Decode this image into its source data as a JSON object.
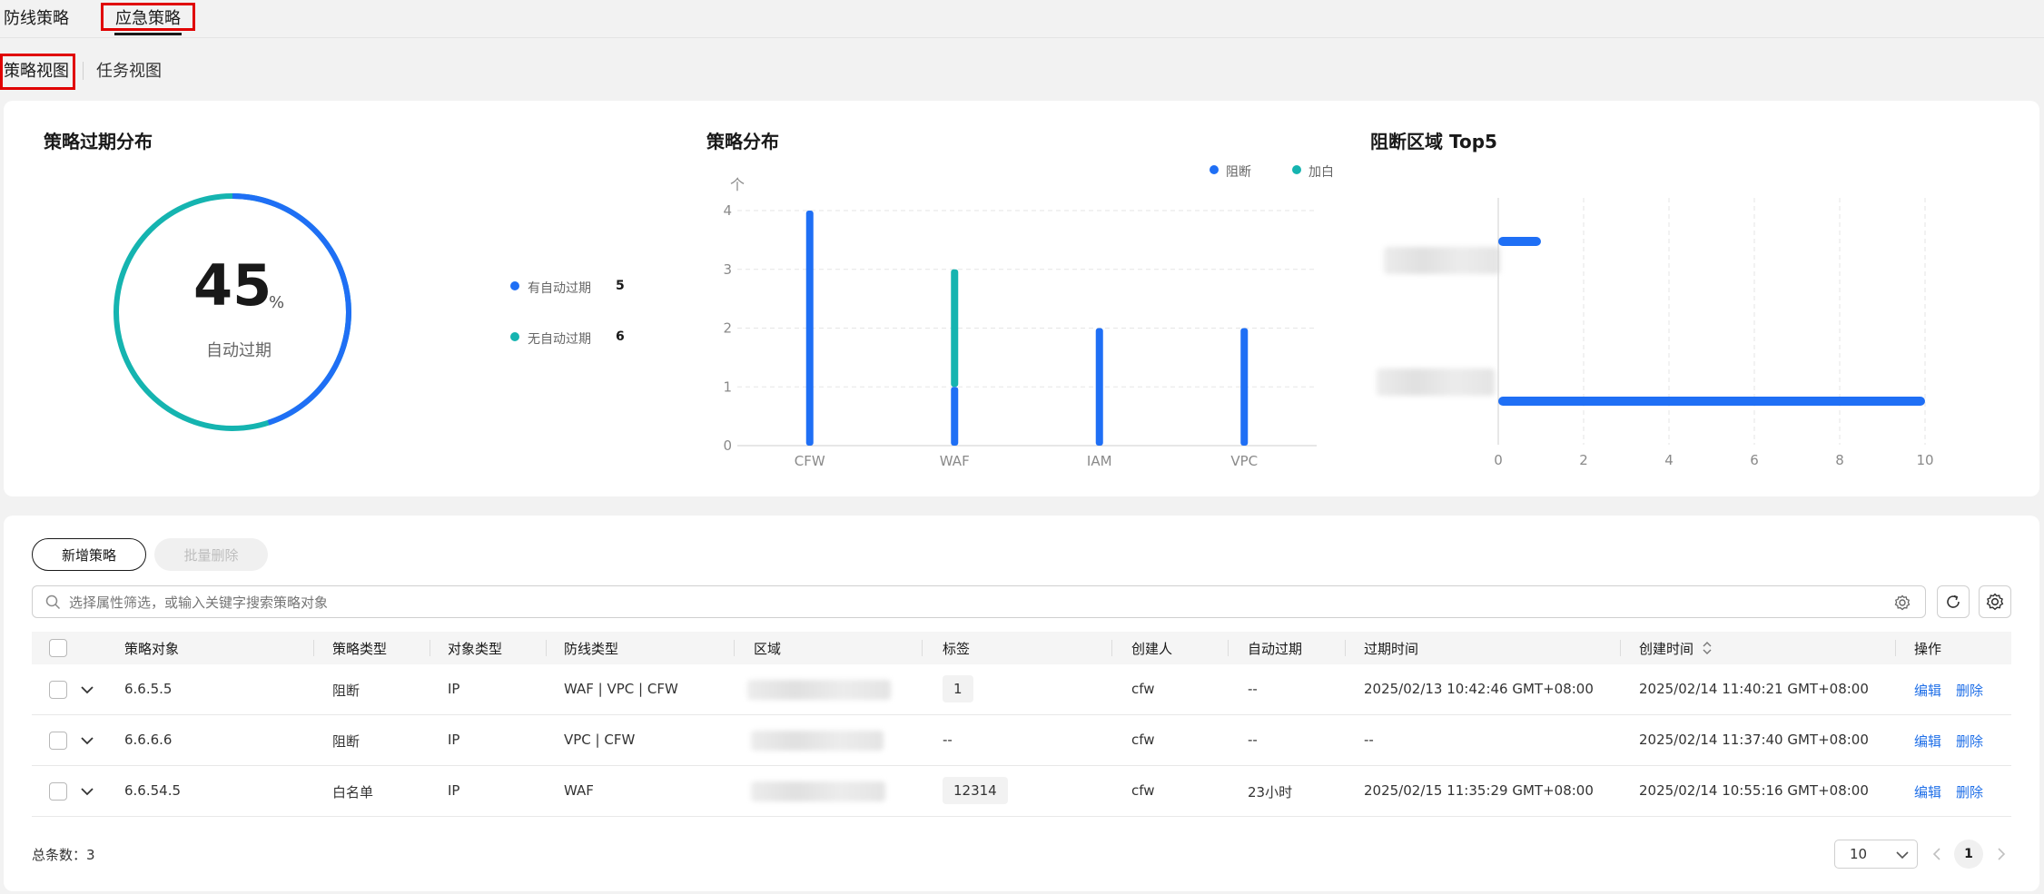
{
  "top_tabs": [
    {
      "label": "防线策略"
    },
    {
      "label": "应急策略"
    }
  ],
  "sub_tabs": [
    {
      "label": "策略视图"
    },
    {
      "label": "任务视图"
    }
  ],
  "expiry_card": {
    "title": "策略过期分布",
    "percent": "45",
    "percent_unit": "%",
    "center_label": "自动过期",
    "legend": [
      {
        "label": "有自动过期",
        "value": "5",
        "color": "#1f6ff5"
      },
      {
        "label": "无自动过期",
        "value": "6",
        "color": "#15b4b0"
      }
    ]
  },
  "dist_card": {
    "title": "策略分布",
    "chart_data": {
      "type": "bar",
      "title": "策略分布",
      "ylabel": "个",
      "categories": [
        "CFW",
        "WAF",
        "IAM",
        "VPC"
      ],
      "series": [
        {
          "name": "阻断",
          "color": "#1f6ff5",
          "values": [
            4,
            1,
            2,
            2
          ]
        },
        {
          "name": "加白",
          "color": "#15b4b0",
          "values": [
            0,
            2,
            0,
            0
          ]
        }
      ],
      "ylim": [
        0,
        4
      ],
      "yticks": [
        "0",
        "1",
        "2",
        "3",
        "4"
      ],
      "stacked": true,
      "legend_position": "top-right",
      "grid": true
    }
  },
  "top5_card": {
    "title": "阻断区域 Top5",
    "chart_data": {
      "type": "bar",
      "orientation": "horizontal",
      "title": "阻断区域 Top5",
      "categories": [
        "",
        ""
      ],
      "values": [
        1,
        10
      ],
      "xlim": [
        0,
        10
      ],
      "xticks": [
        "0",
        "2",
        "4",
        "6",
        "8",
        "10"
      ],
      "color": "#1f6ff5",
      "grid": true
    }
  },
  "toolbar": {
    "add_label": "新增策略",
    "batch_delete_label": "批量删除",
    "search_placeholder": "选择属性筛选，或输入关键字搜索策略对象"
  },
  "table": {
    "columns": [
      "策略对象",
      "策略类型",
      "对象类型",
      "防线类型",
      "区域",
      "标签",
      "创建人",
      "自动过期",
      "过期时间",
      "创建时间",
      "操作"
    ],
    "rows": [
      {
        "object": "6.6.5.5",
        "policy_type": "阻断",
        "object_type": "IP",
        "defense": "WAF | VPC | CFW",
        "tag": "1",
        "creator": "cfw",
        "auto_expire": "--",
        "expire_time": "2025/02/13 10:42:46 GMT+08:00",
        "create_time": "2025/02/14 11:40:21 GMT+08:00",
        "edit": "编辑",
        "delete": "删除"
      },
      {
        "object": "6.6.6.6",
        "policy_type": "阻断",
        "object_type": "IP",
        "defense": "VPC | CFW",
        "tag": "--",
        "creator": "cfw",
        "auto_expire": "--",
        "expire_time": "--",
        "create_time": "2025/02/14 11:37:40 GMT+08:00",
        "edit": "编辑",
        "delete": "删除"
      },
      {
        "object": "6.6.54.5",
        "policy_type": "白名单",
        "object_type": "IP",
        "defense": "WAF",
        "tag": "12314",
        "creator": "cfw",
        "auto_expire": "23小时",
        "expire_time": "2025/02/15 11:35:29 GMT+08:00",
        "create_time": "2025/02/14 10:55:16 GMT+08:00",
        "edit": "编辑",
        "delete": "删除"
      }
    ]
  },
  "footer": {
    "total_label": "总条数：3",
    "page_size": "10",
    "current_page": "1"
  }
}
